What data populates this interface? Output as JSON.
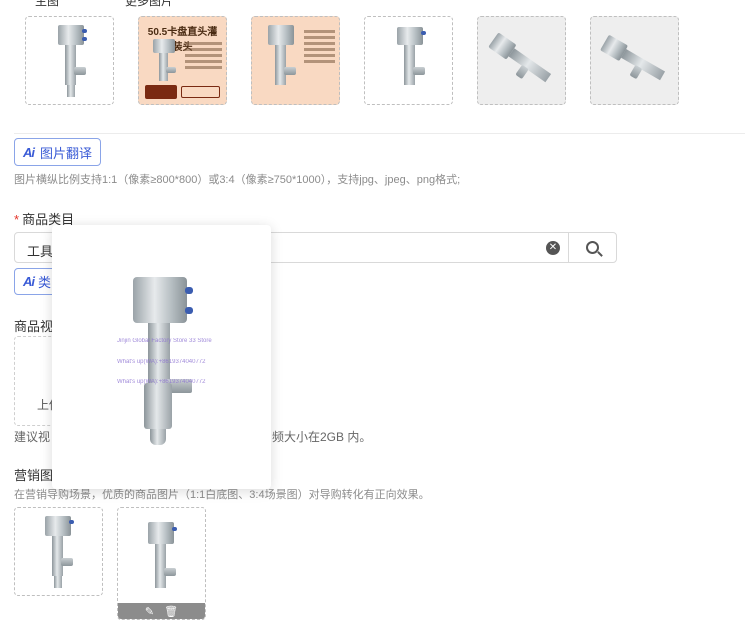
{
  "top_labels": {
    "main": "主图",
    "more": "更多图片"
  },
  "images": {
    "ad_title": "50.5卡盘直头灌装头",
    "ad_badge": "源头工厂 品质保证",
    "ad_badge2": "支持定制 详细可咨询客服沟通"
  },
  "translate": {
    "icon": "Ai",
    "label": "图片翻译"
  },
  "image_hint": "图片横纵比例支持1:1（像素≥800*800）或3:4（像素≥750*1000），支持jpg、jpeg、png格式;",
  "category": {
    "title": "商品类目",
    "required_mark": "*",
    "value": "工具",
    "clear_icon": "clear-icon",
    "search_icon": "search-icon",
    "ai_icon": "Ai",
    "ai_label": "类"
  },
  "video": {
    "title": "商品视",
    "upload_label": "上传",
    "hint_left": "建议视",
    "hint_right": "频大小在2GB 内。"
  },
  "popup": {
    "watermark_store": "Jinjin Global Factory Store 33 Store",
    "watermark_phone": "What's up(WA):+8619374040772"
  },
  "marketing": {
    "title": "营销图",
    "hint": "在营销导购场景，优质的商品图片（1:1白底图、3:4场景图）对导购转化有正向效果。",
    "edit_icon": "edit-icon",
    "delete_icon": "delete-icon"
  }
}
